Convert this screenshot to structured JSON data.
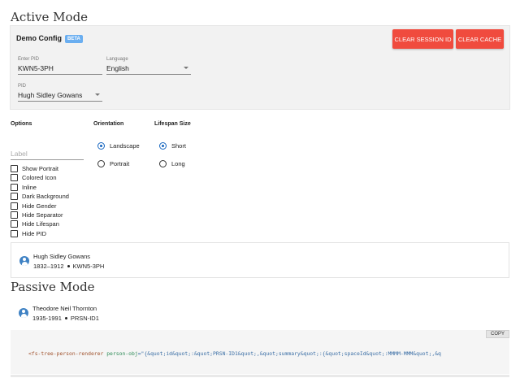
{
  "active_mode": {
    "title": "Active Mode",
    "config": {
      "title": "Demo Config",
      "badge": "BETA",
      "clear_session_label": "CLEAR SESSION ID",
      "clear_cache_label": "CLEAR CACHE",
      "enter_pid": {
        "label": "Enter PID",
        "value": "KWN5-3PH"
      },
      "language": {
        "label": "Language",
        "value": "English"
      },
      "pid": {
        "label": "PID",
        "value": "Hugh Sidley Gowans"
      }
    },
    "options": {
      "heading": "Options",
      "label_placeholder": "Label",
      "checkboxes": [
        {
          "label": "Show Portrait",
          "checked": false
        },
        {
          "label": "Colored Icon",
          "checked": false
        },
        {
          "label": "Inline",
          "checked": false
        },
        {
          "label": "Dark Background",
          "checked": false
        },
        {
          "label": "Hide Gender",
          "checked": false
        },
        {
          "label": "Hide Separator",
          "checked": false
        },
        {
          "label": "Hide Lifespan",
          "checked": false
        },
        {
          "label": "Hide PID",
          "checked": false
        }
      ]
    },
    "orientation": {
      "heading": "Orientation",
      "options": [
        {
          "label": "Landscape",
          "selected": true
        },
        {
          "label": "Portrait",
          "selected": false
        }
      ]
    },
    "lifespan_size": {
      "heading": "Lifespan Size",
      "options": [
        {
          "label": "Short",
          "selected": true
        },
        {
          "label": "Long",
          "selected": false
        }
      ]
    },
    "person": {
      "name": "Hugh Sidley Gowans",
      "lifespan": "1832–1912",
      "pid": "KWN5-3PH",
      "icon": "person-icon"
    }
  },
  "passive_mode": {
    "title": "Passive Mode",
    "person": {
      "name": "Theodore Neil Thornton",
      "lifespan": "1935-1991",
      "pid": "PRSN-ID1",
      "icon": "person-icon"
    },
    "code": {
      "copy_label": "COPY",
      "tag": "<fs-tree-person-renderer",
      "attr": "person-obj",
      "value": "=\"{&quot;id&quot;:&quot;PRSN-ID1&quot;,&quot;summary&quot;:{&quot;spaceId&quot;:MMMM-MMM&quot;,&q"
    }
  },
  "colors": {
    "accent_red": "#f04b3e",
    "badge_blue": "#6aaef0",
    "radio_blue": "#1565c0",
    "avatar_blue": "#3f82c4"
  }
}
